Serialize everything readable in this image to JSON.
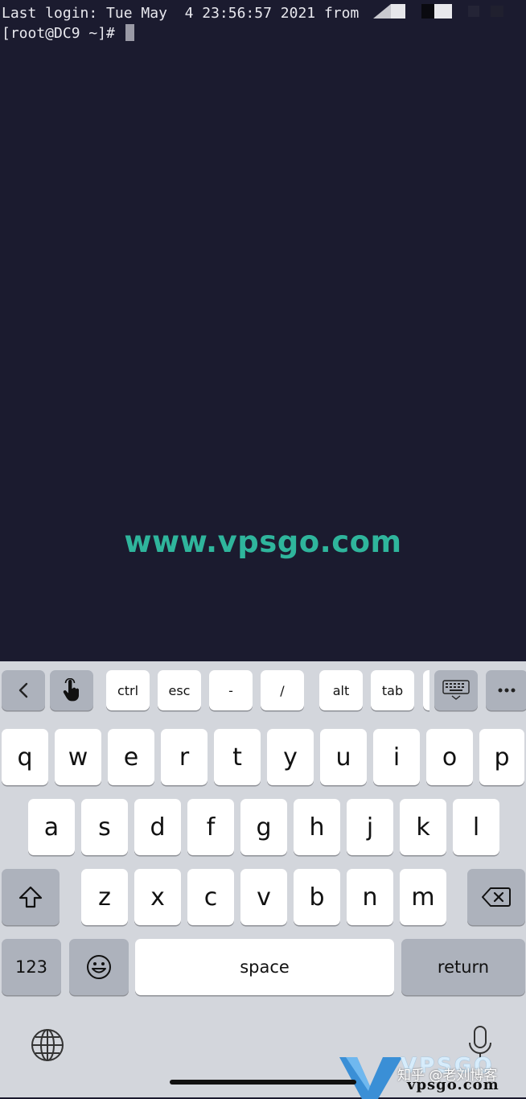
{
  "terminal": {
    "login_line": "Last login: Tue May  4 23:56:57 2021 from",
    "prompt": "[root@DC9 ~]#",
    "watermark": "www.vpsgo.com"
  },
  "accessory_bar": {
    "back_icon": "chevron-left-icon",
    "touch_icon": "hand-pointer-icon",
    "ctrl": "ctrl",
    "esc": "esc",
    "dash": "-",
    "slash": "/",
    "alt": "alt",
    "tab": "tab",
    "keyboard_icon": "keyboard-hide-icon",
    "more_icon": "ellipsis-icon"
  },
  "keyboard": {
    "row1": [
      "q",
      "w",
      "e",
      "r",
      "t",
      "y",
      "u",
      "i",
      "o",
      "p"
    ],
    "row2": [
      "a",
      "s",
      "d",
      "f",
      "g",
      "h",
      "j",
      "k",
      "l"
    ],
    "row3": [
      "z",
      "x",
      "c",
      "v",
      "b",
      "n",
      "m"
    ],
    "numbers_label": "123",
    "space_label": "space",
    "return_label": "return",
    "shift_icon": "shift-icon",
    "backspace_icon": "backspace-icon",
    "emoji_icon": "emoji-icon",
    "globe_icon": "globe-icon",
    "mic_icon": "microphone-icon"
  },
  "watermarks": {
    "logo_text": "VPSGO",
    "logo_domain": "vpsgo.com",
    "zhihu": "知乎 @老刘博客"
  },
  "colors": {
    "terminal_bg": "#1b1b2f",
    "watermark_green": "#2fb59c",
    "keyboard_bg": "#d3d6dc"
  }
}
